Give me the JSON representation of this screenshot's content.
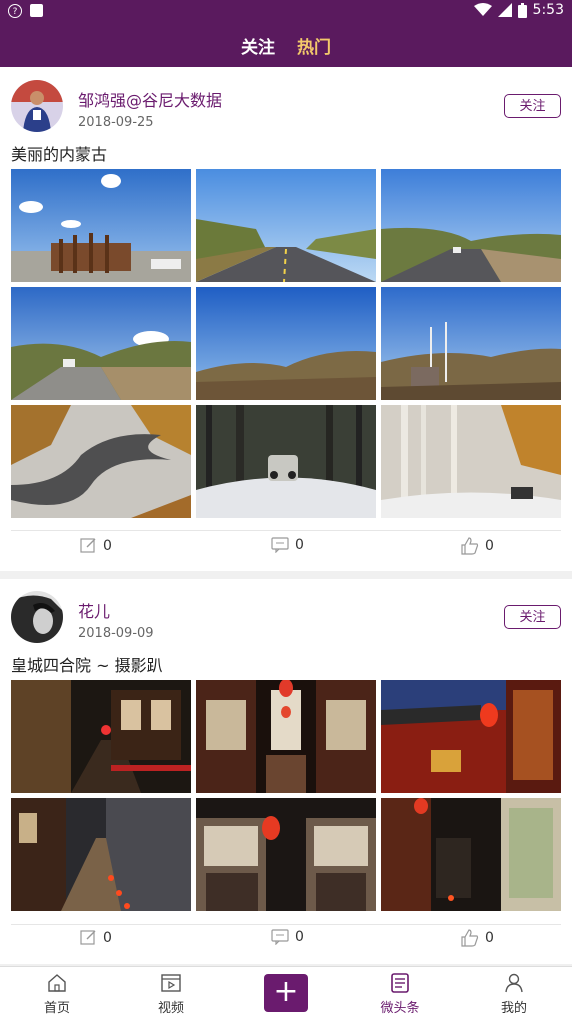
{
  "status_bar": {
    "time": "5:53",
    "left_icons": [
      "accessibility-icon",
      "app-icon"
    ],
    "right_icons": [
      "wifi-icon",
      "signal-icon",
      "battery-icon"
    ]
  },
  "header": {
    "tabs": [
      {
        "label": "关注",
        "active": false
      },
      {
        "label": "热门",
        "active": true
      }
    ],
    "bg_color": "#5a1a5e",
    "active_color": "#f3c96b"
  },
  "posts": [
    {
      "author": "邹鸿强@谷尼大数据",
      "date": "2018-09-25",
      "follow_label": "关注",
      "title": "美丽的内蒙古",
      "photos": [
        "monument-field",
        "road-forest",
        "road-hills",
        "road-valley",
        "hills-field",
        "hut-field",
        "winding-road-snow",
        "jeep-snow-forest",
        "birch-snow"
      ],
      "edit_count": "0",
      "comment_count": "0",
      "like_count": "0"
    },
    {
      "author": "花儿",
      "date": "2018-09-09",
      "follow_label": "关注",
      "title": "皇城四合院 ~ 摄影趴",
      "photos": [
        "alley-lanterns",
        "courtyard-lanterns",
        "red-gate",
        "brick-alley",
        "lattice-lantern",
        "courtyard-corridor"
      ],
      "edit_count": "0",
      "comment_count": "0",
      "like_count": "0"
    }
  ],
  "bottom_nav": [
    {
      "label": "首页",
      "icon": "home-icon",
      "active": false
    },
    {
      "label": "视频",
      "icon": "video-icon",
      "active": false
    },
    {
      "label": "+",
      "icon": "plus-icon",
      "active": false
    },
    {
      "label": "微头条",
      "icon": "article-icon",
      "active": true
    },
    {
      "label": "我的",
      "icon": "user-icon",
      "active": false
    }
  ]
}
